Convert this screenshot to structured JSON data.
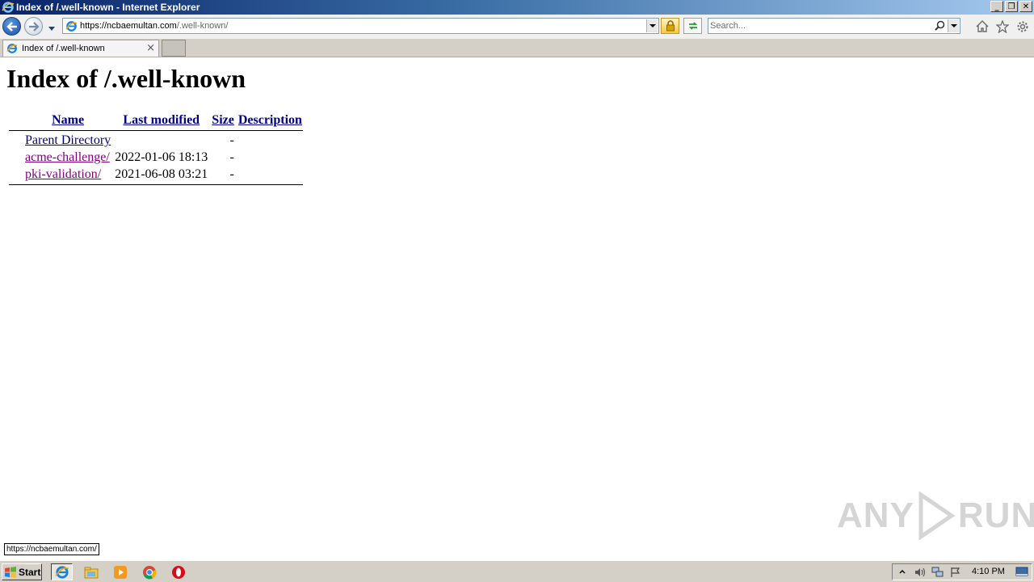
{
  "window": {
    "title": "Index of /.well-known - Internet Explorer",
    "minimize_glyph": "_",
    "restore_glyph": "❐",
    "close_glyph": "✕"
  },
  "navbar": {
    "url_host": "https://ncbaemultan.com",
    "url_path": "/.well-known/",
    "search_placeholder": "Search..."
  },
  "tabs": [
    {
      "label": "Index of /.well-known",
      "close_glyph": "×"
    }
  ],
  "page": {
    "title": "Index of /.well-known",
    "columns": [
      "Name",
      "Last modified",
      "Size",
      "Description"
    ],
    "rows": [
      {
        "name": "Parent Directory",
        "modified": "",
        "size": "-",
        "description": "",
        "visited": false
      },
      {
        "name": "acme-challenge/",
        "modified": "2022-01-06 18:13",
        "size": "-",
        "description": "",
        "visited": true
      },
      {
        "name": "pki-validation/",
        "modified": "2021-06-08 03:21",
        "size": "-",
        "description": "",
        "visited": true
      }
    ]
  },
  "status_bar": {
    "hover_url": "https://ncbaemultan.com/"
  },
  "watermark": {
    "text_left": "ANY",
    "text_right": "RUN"
  },
  "taskbar": {
    "start_label": "Start",
    "apps": [
      "ie-icon",
      "explorer-folder-icon",
      "media-player-icon",
      "chrome-icon",
      "opera-icon"
    ],
    "clock": "4:10 PM"
  },
  "colors": {
    "link": "#000080",
    "visited_link": "#800080",
    "title_bar_start": "#0a246a",
    "taskbar": "#d4d0c8"
  }
}
